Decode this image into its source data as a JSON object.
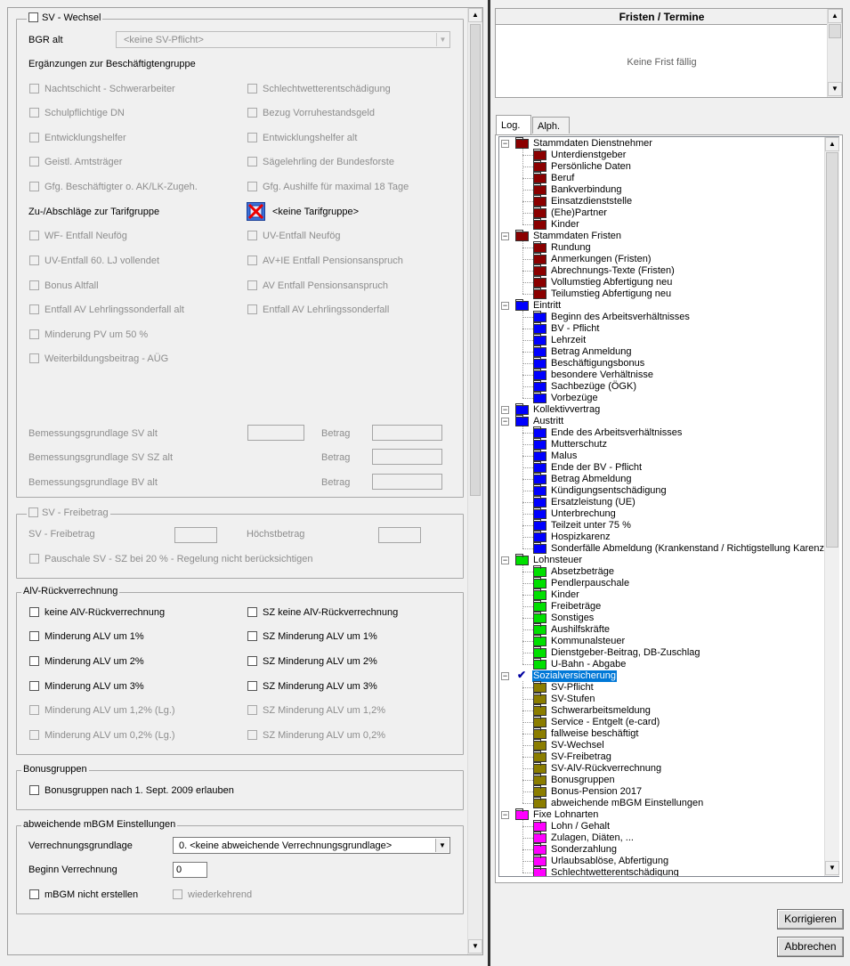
{
  "sv_wechsel": {
    "title": "SV - Wechsel",
    "bgr_label": "BGR alt",
    "bgr_value": "<keine SV-Pflicht>",
    "ergaenzungen_heading": "Ergänzungen zur Beschäftigtengruppe",
    "ergaenzungen_left": [
      "Nachtschicht - Schwerarbeiter",
      "Schulpflichtige DN",
      "Entwicklungshelfer",
      "Geistl. Amtsträger",
      "Gfg. Beschäftigter o. AK/LK-Zugeh."
    ],
    "ergaenzungen_right": [
      "Schlechtwetterentschädigung",
      "Bezug Vorruhestandsgeld",
      "Entwicklungshelfer alt",
      "Sägelehrling der Bundesforste",
      "Gfg. Aushilfe für maximal 18 Tage"
    ],
    "zuab_label": "Zu-/Abschläge zur Tarifgruppe",
    "tarif_value": "<keine Tarifgruppe>",
    "zuab_left": [
      "WF- Entfall Neufög",
      "UV-Entfall 60. LJ vollendet",
      "Bonus Altfall",
      "Entfall AV Lehrlingssonderfall alt",
      "Minderung PV um 50 %",
      "Weiterbildungsbeitrag - AÜG"
    ],
    "zuab_right": [
      "UV-Entfall Neufög",
      "AV+IE Entfall Pensionsanspruch",
      "AV Entfall Pensionsanspruch",
      "Entfall AV Lehrlingssonderfall"
    ],
    "bemessung_sv": "Bemessungsgrundlage SV alt",
    "bemessung_svsz": "Bemessungsgrundlage SV SZ alt",
    "bemessung_bv": "Bemessungsgrundlage BV alt",
    "betrag": "Betrag"
  },
  "sv_freibetrag": {
    "title": "SV - Freibetrag",
    "freibetrag_label": "SV - Freibetrag",
    "hoechst_label": "Höchstbetrag",
    "pauschale": "Pauschale SV - SZ bei 20 % - Regelung nicht berücksichtigen"
  },
  "alv": {
    "title": "AlV-Rückverrechnung",
    "left": [
      "keine AlV-Rückverrechnung",
      "Minderung ALV um 1%",
      "Minderung ALV um 2%",
      "Minderung ALV um 3%",
      "Minderung ALV um 1,2% (Lg.)",
      "Minderung ALV um 0,2% (Lg.)"
    ],
    "right": [
      "SZ keine AlV-Rückverrechnung",
      "SZ Minderung ALV um 1%",
      "SZ Minderung ALV um 2%",
      "SZ Minderung ALV um 3%",
      "SZ Minderung ALV um 1,2%",
      "SZ Minderung ALV um 0,2%"
    ]
  },
  "bonus": {
    "title": "Bonusgruppen",
    "option": "Bonusgruppen nach 1. Sept. 2009 erlauben"
  },
  "mbgm": {
    "title": "abweichende mBGM Einstellungen",
    "verrechnung_label": "Verrechnungsgrundlage",
    "verrechnung_value": "0.  <keine abweichende Verrechnungsgrundlage>",
    "beginn_label": "Beginn Verrechnung",
    "beginn_value": "0",
    "nicht_erstellen": "mBGM nicht erstellen",
    "wiederkehrend": "wiederkehrend"
  },
  "fristen": {
    "title": "Fristen / Termine",
    "empty": "Keine Frist fällig"
  },
  "tabs": [
    "Log.",
    "Alph."
  ],
  "tree": [
    {
      "label": "Stammdaten Dienstnehmer",
      "color": "#8b0000",
      "children": [
        "Unterdienstgeber",
        "Persönliche Daten",
        "Beruf",
        "Bankverbindung",
        "Einsatzdienststelle",
        "(Ehe)Partner",
        "Kinder"
      ]
    },
    {
      "label": "Stammdaten Fristen",
      "color": "#8b0000",
      "children": [
        "Rundung",
        "Anmerkungen (Fristen)",
        "Abrechnungs-Texte (Fristen)",
        "Vollumstieg Abfertigung neu",
        "Teilumstieg Abfertigung neu"
      ]
    },
    {
      "label": "Eintritt",
      "color": "#0000ff",
      "children": [
        "Beginn des Arbeitsverhältnisses",
        "BV - Pflicht",
        "Lehrzeit",
        "Betrag Anmeldung",
        "Beschäftigungsbonus",
        "besondere Verhältnisse",
        "Sachbezüge (ÖGK)",
        "Vorbezüge"
      ]
    },
    {
      "label": "Kollektivvertrag",
      "color": "#0000ff",
      "children": []
    },
    {
      "label": "Austritt",
      "color": "#0000ff",
      "children": [
        "Ende des Arbeitsverhältnisses",
        "Mutterschutz",
        "Malus",
        "Ende der BV - Pflicht",
        "Betrag Abmeldung",
        "Kündigungsentschädigung",
        "Ersatzleistung (UE)",
        "Unterbrechung",
        "Teilzeit unter 75 %",
        "Hospizkarenz",
        "Sonderfälle Abmeldung (Krankenstand / Richtigstellung Karenz)"
      ]
    },
    {
      "label": "Lohnsteuer",
      "color": "#00e000",
      "children": [
        "Absetzbeträge",
        "Pendlerpauschale",
        "Kinder",
        "Freibeträge",
        "Sonstiges",
        "Aushilfskräfte",
        "Kommunalsteuer",
        "Dienstgeber-Beitrag, DB-Zuschlag",
        "U-Bahn - Abgabe"
      ]
    },
    {
      "label": "Sozialversicherung",
      "color": "#8b7d00",
      "children": [
        "SV-Pflicht",
        "SV-Stufen",
        "Schwerarbeitsmeldung",
        "Service - Entgelt (e-card)",
        "fallweise beschäftigt",
        "SV-Wechsel",
        "SV-Freibetrag",
        "SV-AlV-Rückverrechnung",
        "Bonusgruppen",
        "Bonus-Pension 2017",
        "abweichende mBGM Einstellungen"
      ]
    },
    {
      "label": "Fixe Lohnarten",
      "color": "#ff00ff",
      "children": [
        "Lohn / Gehalt",
        "Zulagen, Diäten, ...",
        "Sonderzahlung",
        "Urlaubsablöse, Abfertigung",
        "Schlechtwetterentschädigung"
      ]
    }
  ],
  "buttons": {
    "korrigieren": "Korrigieren",
    "abbrechen": "Abbrechen"
  }
}
